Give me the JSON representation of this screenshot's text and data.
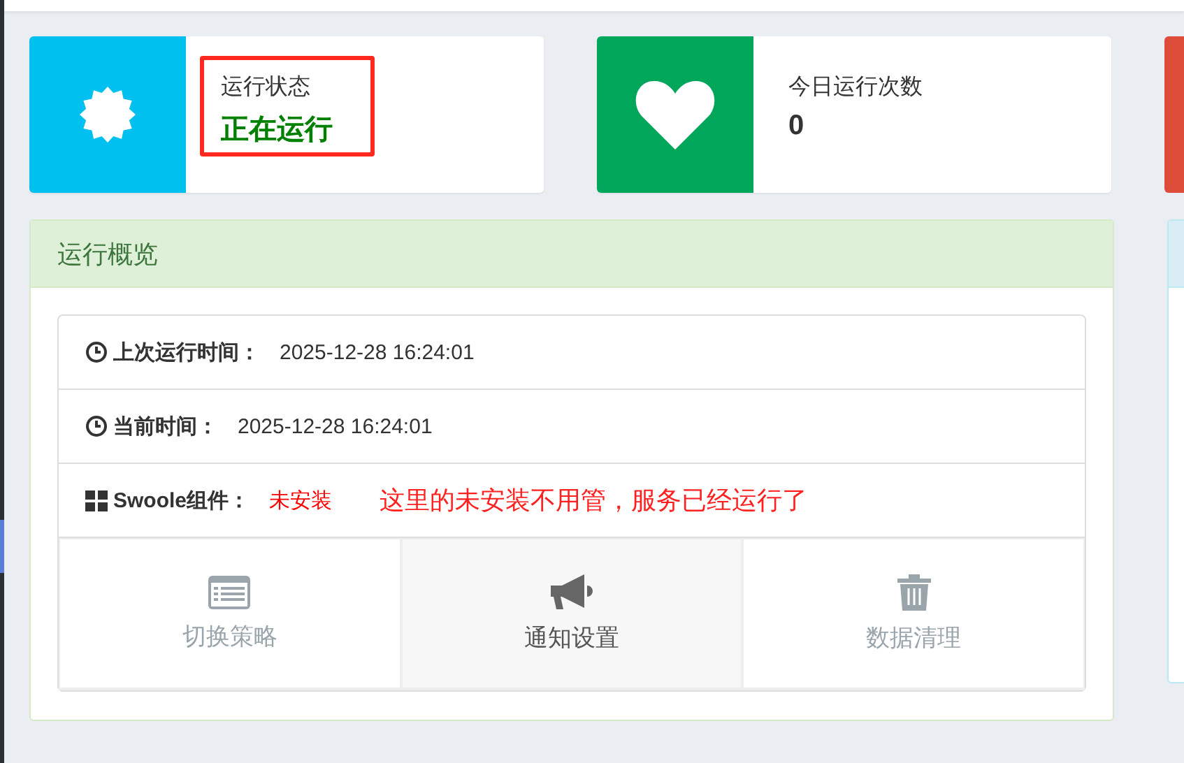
{
  "stat_cards": [
    {
      "kind": "status",
      "color": "#00c0ef",
      "label": "运行状态",
      "value": "正在运行",
      "annotated": true
    },
    {
      "kind": "count",
      "color": "#00a65a",
      "label": "今日运行次数",
      "value": "0",
      "annotated": false
    },
    {
      "kind": "empty",
      "color": "#dd4b39"
    }
  ],
  "overview": {
    "title": "运行概览",
    "rows": [
      {
        "label": "上次运行时间：",
        "value": "2025-12-28 16:24:01",
        "alert": false
      },
      {
        "label": "当前时间：",
        "value": "2025-12-28 16:24:01",
        "alert": false
      },
      {
        "label": "Swoole组件：",
        "value": "未安装",
        "alert": true,
        "note": "这里的未安装不用管，服务已经运行了"
      }
    ],
    "actions": [
      {
        "label": "切换策略",
        "highlighted": false
      },
      {
        "label": "通知设置",
        "highlighted": true
      },
      {
        "label": "数据清理",
        "highlighted": false
      }
    ]
  },
  "side_panel": {
    "kind": "info"
  }
}
